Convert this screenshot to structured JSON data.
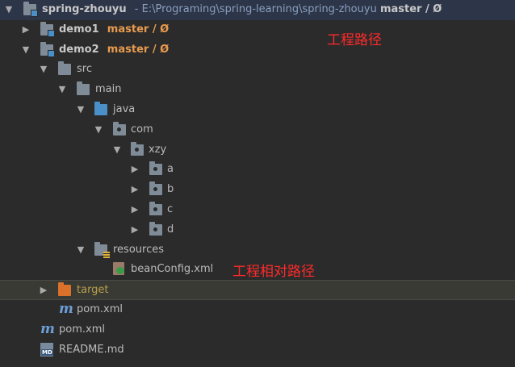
{
  "root": {
    "name": "spring-zhouyu",
    "path": "- E:\\Programing\\spring-learning\\spring-zhouyu",
    "branch": "master / Ø"
  },
  "demo1": {
    "name": "demo1",
    "branch": "master / Ø"
  },
  "demo2": {
    "name": "demo2",
    "branch": "master / Ø"
  },
  "folders": {
    "src": "src",
    "main": "main",
    "java": "java",
    "com": "com",
    "xzy": "xzy",
    "a": "a",
    "b": "b",
    "c": "c",
    "d": "d",
    "resources": "resources",
    "target": "target"
  },
  "files": {
    "beanconfig": "beanConfig.xml",
    "demo2_pom": "pom.xml",
    "root_pom": "pom.xml",
    "readme": "README.md"
  },
  "icons": {
    "maven": "m",
    "markdown": "MD"
  },
  "annotations": {
    "project_path": "工程路径",
    "relative_path": "工程相对路径"
  },
  "colors": {
    "background": "#2b2b2b",
    "branch": "#e89b4f",
    "annotation": "#ff2a2a",
    "source_folder": "#4a8fc7",
    "excluded_folder": "#d9712b"
  }
}
